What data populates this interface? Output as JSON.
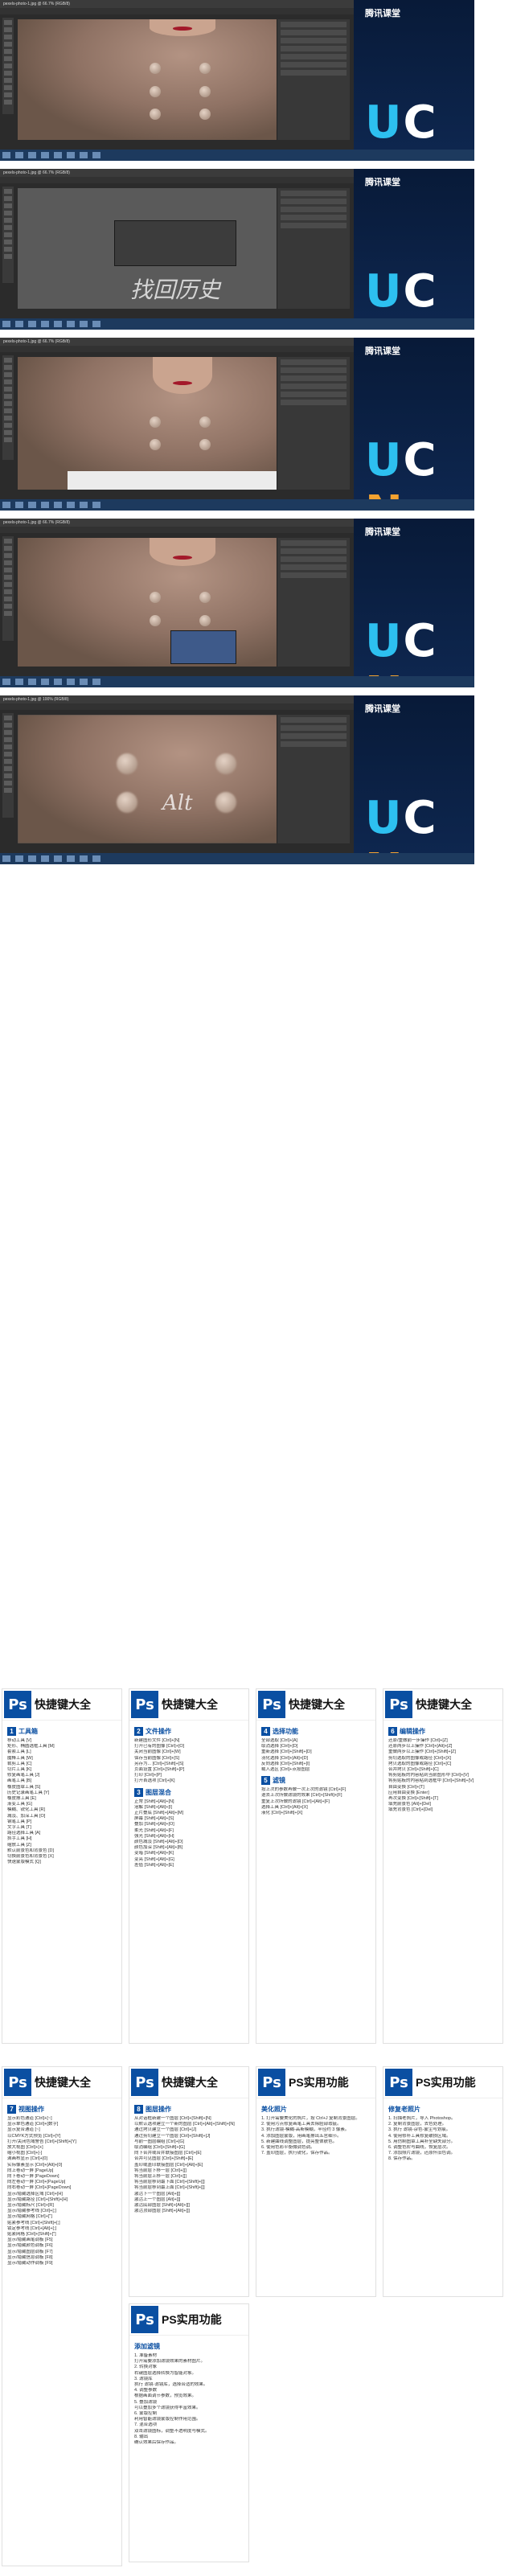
{
  "screens": [
    {
      "title": "pexels-photo-1.jpg @ 66.7% (RGB/8)"
    },
    {
      "title": "pexels-photo-1.jpg @ 66.7% (RGB/8)",
      "overlay": "找回历史"
    },
    {
      "title": "pexels-photo-1.jpg @ 66.7% (RGB/8)"
    },
    {
      "title": "pexels-photo-1.jpg @ 66.7% (RGB/8)"
    },
    {
      "title": "pexels-photo-1.jpg @ 100% (RGB/8)",
      "overlay": "Alt"
    }
  ],
  "brand": {
    "name": "腾讯课堂",
    "u": "U",
    "c": "C",
    "n": "N"
  },
  "cards": [
    {
      "ps": "Ps",
      "title": "快捷键大全",
      "sections": [
        {
          "num": "1",
          "name": "工具箱"
        }
      ]
    },
    {
      "ps": "Ps",
      "title": "快捷键大全",
      "sections": [
        {
          "num": "2",
          "name": "文件操作"
        },
        {
          "num": "3",
          "name": "图层混合"
        }
      ]
    },
    {
      "ps": "Ps",
      "title": "快捷键大全",
      "sections": [
        {
          "num": "4",
          "name": "选择功能"
        },
        {
          "num": "5",
          "name": "滤镜"
        }
      ]
    },
    {
      "ps": "Ps",
      "title": "快捷键大全",
      "sections": [
        {
          "num": "6",
          "name": "编辑操作"
        }
      ]
    },
    {
      "ps": "Ps",
      "title": "快捷键大全",
      "sections": [
        {
          "num": "7",
          "name": "视图操作"
        }
      ]
    },
    {
      "ps": "Ps",
      "title": "快捷键大全",
      "sections": [
        {
          "num": "8",
          "name": "图层操作"
        }
      ]
    },
    {
      "ps": "Ps",
      "title": "PS实用功能",
      "sections": [
        {
          "num": "",
          "name": "美化照片"
        }
      ]
    },
    {
      "ps": "Ps",
      "title": "PS实用功能",
      "sections": [
        {
          "num": "",
          "name": "修复老照片"
        }
      ]
    },
    {
      "ps": "Ps",
      "title": "PS实用功能",
      "sections": [
        {
          "num": "",
          "name": "添加滤镜"
        }
      ]
    }
  ],
  "card_lines": {
    "c0": [
      "移动工具 [V]",
      "矩形、椭圆选框工具 [M]",
      "套索工具 [L]",
      "魔棒工具 [W]",
      "裁剪工具 [C]",
      "切片工具 [K]",
      "修复画笔工具 [J]",
      "画笔工具 [B]",
      "橡皮图章工具 [S]",
      "历史记录画笔工具 [Y]",
      "橡皮擦工具 [E]",
      "渐变工具 [G]",
      "模糊、锐化工具 [R]",
      "减淡、加深工具 [O]",
      "钢笔工具 [P]",
      "文字工具 [T]",
      "路径选择工具 [A]",
      "抓手工具 [H]",
      "缩放工具 [Z]",
      "默认前景色和背景色 [D]",
      "切换前景色和背景色 [X]",
      "快速蒙版模式 [Q]"
    ],
    "c1": [
      "新建图形文件 [Ctrl]+[N]",
      "打开已有的图像 [Ctrl]+[O]",
      "关闭当前图像 [Ctrl]+[W]",
      "保存当前图像 [Ctrl]+[S]",
      "另存为... [Ctrl]+[Shift]+[S]",
      "页面设置 [Ctrl]+[Shift]+[P]",
      "打印 [Ctrl]+[P]",
      "打开首选项 [Ctrl]+[K]"
    ],
    "c1b": [
      "正常 [Shift]+[Alt]+[N]",
      "溶解 [Shift]+[Alt]+[I]",
      "正片叠底 [Shift]+[Alt]+[M]",
      "屏幕 [Shift]+[Alt]+[S]",
      "叠加 [Shift]+[Alt]+[O]",
      "柔光 [Shift]+[Alt]+[F]",
      "强光 [Shift]+[Alt]+[H]",
      "颜色减淡 [Shift]+[Alt]+[D]",
      "颜色加深 [Shift]+[Alt]+[B]",
      "变暗 [Shift]+[Alt]+[K]",
      "变亮 [Shift]+[Alt]+[G]",
      "差值 [Shift]+[Alt]+[E]"
    ],
    "c2": [
      "全部选取 [Ctrl]+[A]",
      "取消选择 [Ctrl]+[D]",
      "重新选择 [Ctrl]+[Shift]+[D]",
      "羽化选择 [Ctrl]+[Alt]+[D]",
      "反向选择 [Ctrl]+[Shift]+[I]",
      "载入选区 [Ctrl]+点按图层"
    ],
    "c2b": [
      "按上次的参数再做一次上次的滤镜 [Ctrl]+[F]",
      "退去上次所做滤镜的效果 [Ctrl]+[Shift]+[F]",
      "重复上次所做的滤镜 [Ctrl]+[Alt]+[F]",
      "选择工具 [Ctrl]+[Alt]+[X]",
      "液化 [Ctrl]+[Shift]+[X]"
    ],
    "c3": [
      "还原/重做前一步操作 [Ctrl]+[Z]",
      "还原两步以上操作 [Ctrl]+[Alt]+[Z]",
      "重做两步以上操作 [Ctrl]+[Shift]+[Z]",
      "剪切选取的图像或路径 [Ctrl]+[X]",
      "拷贝选取的图像或路径 [Ctrl]+[C]",
      "合并拷贝 [Ctrl]+[Shift]+[C]",
      "将剪贴板的内容粘到当前图形中 [Ctrl]+[V]",
      "将剪贴板的内容粘到选框中 [Ctrl]+[Shift]+[V]",
      "自由变换 [Ctrl]+[T]",
      "应用自由变换 [Enter]",
      "再次变换 [Ctrl]+[Shift]+[T]",
      "填充前景色 [Alt]+[Del]",
      "填充背景色 [Ctrl]+[Del]"
    ],
    "c4": [
      "显示彩色通道 [Ctrl]+[~]",
      "显示单色通道 [Ctrl]+[数字]",
      "显示复合通道 [~]",
      "以CMYK方式预览 [Ctrl]+[Y]",
      "打开/关闭色域警告 [Ctrl]+[Shift]+[Y]",
      "放大视图 [Ctrl]+[+]",
      "缩小视图 [Ctrl]+[-]",
      "满画布显示 [Ctrl]+[0]",
      "实际像素显示 [Ctrl]+[Alt]+[0]",
      "向上卷动一屏 [PageUp]",
      "向下卷动一屏 [PageDown]",
      "向左卷动一屏 [Ctrl]+[PageUp]",
      "向右卷动一屏 [Ctrl]+[PageDown]",
      "显示/隐藏选择区域 [Ctrl]+[H]",
      "显示/隐藏路径 [Ctrl]+[Shift]+[H]",
      "显示/隐藏标尺 [Ctrl]+[R]",
      "显示/隐藏参考线 [Ctrl]+[;]",
      "显示/隐藏网格 [Ctrl]+[\"]",
      "贴紧参考线 [Ctrl]+[Shift]+[;]",
      "锁定参考线 [Ctrl]+[Alt]+[;]",
      "贴紧网格 [Ctrl]+[Shift]+[\"]",
      "显示/隐藏画笔调板 [F5]",
      "显示/隐藏颜色调板 [F6]",
      "显示/隐藏图层调板 [F7]",
      "显示/隐藏信息调板 [F8]",
      "显示/隐藏动作调板 [F9]"
    ],
    "c5": [
      "从对话框新建一个图层 [Ctrl]+[Shift]+[N]",
      "以默认选项建立一个新的图层 [Ctrl]+[Alt]+[Shift]+[N]",
      "通过拷贝建立一个图层 [Ctrl]+[J]",
      "通过剪切建立一个图层 [Ctrl]+[Shift]+[J]",
      "与前一图层编组 [Ctrl]+[G]",
      "取消编组 [Ctrl]+[Shift]+[G]",
      "向下合并或合并联接图层 [Ctrl]+[E]",
      "合并可见图层 [Ctrl]+[Shift]+[E]",
      "盖印或盖印联接图层 [Ctrl]+[Alt]+[E]",
      "将当前层下移一层 [Ctrl]+[[]",
      "将当前层上移一层 [Ctrl]+[]]",
      "将当前层移到最下面 [Ctrl]+[Shift]+[[]",
      "将当前层移到最上面 [Ctrl]+[Shift]+[]]",
      "激活下一个图层 [Alt]+[[]",
      "激活上一个图层 [Alt]+[]]",
      "激活底部图层 [Shift]+[Alt]+[[]",
      "激活顶部图层 [Shift]+[Alt]+[]]"
    ],
    "c6": [
      "1. 打开需要美化的照片，按 Ctrl+J 复制背景图层。",
      "2. 使用污点修复画笔工具去除脸部瑕疵。",
      "3. 执行滤镜-模糊-高斯模糊，半径约 3 像素。",
      "4. 添加图层蒙版，用画笔擦出五官细节。",
      "5. 新建曲线调整图层，提亮整体肤色。",
      "6. 使用色彩平衡微调色调。",
      "7. 盖印图层，执行锐化，保存作品。"
    ],
    "c7": [
      "1. 扫描老照片，导入 Photoshop。",
      "2. 复制背景图层，去色处理。",
      "3. 执行 滤镜-杂色-蒙尘与划痕。",
      "4. 使用修补工具修复破损区域。",
      "5. 用仿制图章工具补全缺失部分。",
      "6. 调整色阶与曲线，恢复层次。",
      "7. 添加照片滤镜，还原怀旧色调。",
      "8. 保存作品。"
    ],
    "c8": [
      "1. 准备素材",
      "打开需要添加滤镜效果的素材图片。",
      "2. 转换对象",
      "右键图层选择转换为智能对象。",
      "3. 滤镜库",
      "执行 滤镜-滤镜库，选择合适的效果。",
      "4. 调整参数",
      "根据画面调节参数，预览效果。",
      "5. 叠加滤镜",
      "可以叠加多个滤镜获得丰富效果。",
      "6. 蒙版控制",
      "利用智能滤镜蒙版控制作用范围。",
      "7. 混合选项",
      "双击滤镜图标，调整不透明度与模式。",
      "8. 输出",
      "确认效果后保存作品。"
    ]
  }
}
